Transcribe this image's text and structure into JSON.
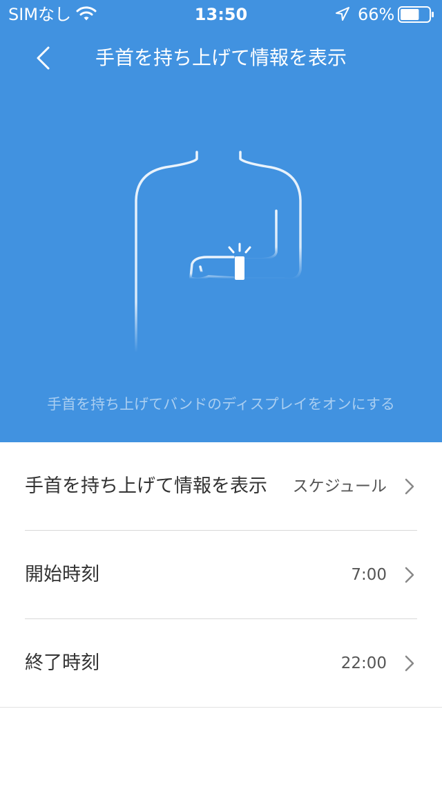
{
  "status_bar": {
    "carrier": "SIMなし",
    "time": "13:50",
    "battery_percent": "66%",
    "battery_level": 0.66,
    "icons": [
      "wifi-icon",
      "location-arrow-icon",
      "battery-icon"
    ]
  },
  "nav": {
    "title": "手首を持ち上げて情報を表示",
    "back_icon": "chevron-left-icon"
  },
  "hero": {
    "illustration": "person-raising-wrist-band-icon",
    "caption": "手首を持ち上げてバンドのディスプレイをオンにする"
  },
  "settings": {
    "items": [
      {
        "label": "手首を持ち上げて情報を表示",
        "value": "スケジュール"
      },
      {
        "label": "開始時刻",
        "value": "7:00"
      },
      {
        "label": "終了時刻",
        "value": "22:00"
      }
    ]
  },
  "colors": {
    "accent": "#4192e0",
    "text_primary": "#333333",
    "text_secondary": "#555555",
    "divider": "#d8d8d8"
  }
}
